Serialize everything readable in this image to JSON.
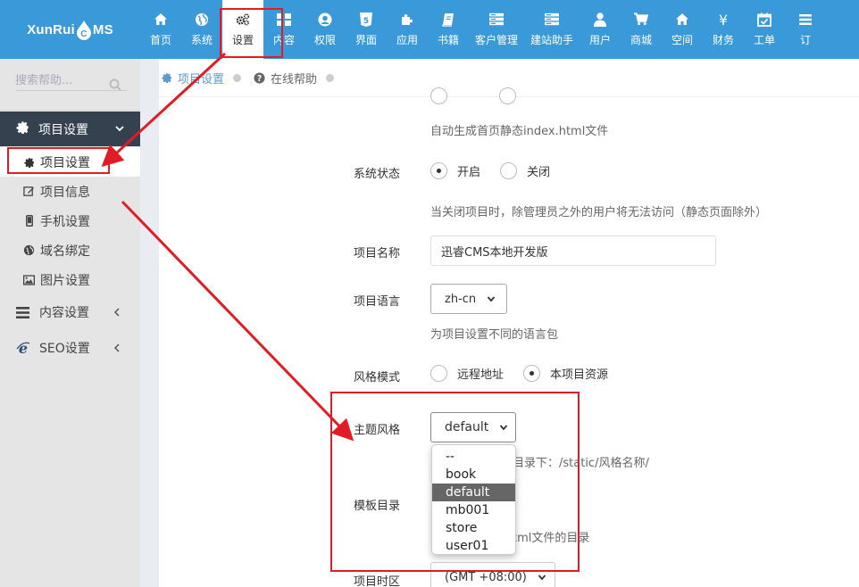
{
  "logo": {
    "text_left": "XunRui",
    "text_mid": "C",
    "text_right": "MS"
  },
  "nav": [
    {
      "label": "首页",
      "icon": "home-icon"
    },
    {
      "label": "系统",
      "icon": "globe-icon"
    },
    {
      "label": "设置",
      "icon": "gears-icon",
      "active": true
    },
    {
      "label": "内容",
      "icon": "th-large-icon"
    },
    {
      "label": "权限",
      "icon": "user-circle-icon"
    },
    {
      "label": "界面",
      "icon": "html5-icon"
    },
    {
      "label": "应用",
      "icon": "puzzle-icon"
    },
    {
      "label": "书籍",
      "icon": "book-icon"
    },
    {
      "label": "客户管理",
      "icon": "server-icon"
    },
    {
      "label": "建站助手",
      "icon": "server-icon"
    },
    {
      "label": "用户",
      "icon": "user-icon"
    },
    {
      "label": "商城",
      "icon": "cart-icon"
    },
    {
      "label": "空间",
      "icon": "home-icon"
    },
    {
      "label": "财务",
      "icon": "yen-icon"
    },
    {
      "label": "工单",
      "icon": "calendar-check-icon"
    },
    {
      "label": "订",
      "icon": "bars-icon"
    }
  ],
  "sidebar": {
    "search_placeholder": "搜索帮助...",
    "group_open": {
      "label": "项目设置"
    },
    "sub_items": [
      {
        "label": "项目设置",
        "icon": "gear-icon"
      },
      {
        "label": "项目信息",
        "icon": "edit-icon"
      },
      {
        "label": "手机设置",
        "icon": "mobile-icon"
      },
      {
        "label": "域名绑定",
        "icon": "globe-icon"
      },
      {
        "label": "图片设置",
        "icon": "image-icon"
      }
    ],
    "groups": [
      {
        "label": "内容设置",
        "icon": "bars-icon"
      },
      {
        "label": "SEO设置",
        "icon": "ie-icon"
      }
    ]
  },
  "breadcrumb": [
    {
      "label": "项目设置",
      "icon": "gear-icon"
    },
    {
      "label": "在线帮助",
      "icon": "question-circle-icon"
    }
  ],
  "form": {
    "index_help": "自动生成首页静态index.html文件",
    "status": {
      "label": "系统状态",
      "opt_on": "开启",
      "opt_off": "关闭",
      "selected": "开启",
      "help": "当关闭项目时，除管理员之外的用户将无法访问（静态页面除外）"
    },
    "name": {
      "label": "项目名称",
      "value": "迅睿CMS本地开发版"
    },
    "language": {
      "label": "项目语言",
      "value": "zh-cn",
      "help": "为项目设置不同的语言包"
    },
    "style_mode": {
      "label": "风格模式",
      "opt_remote": "远程地址",
      "opt_local": "本项目资源",
      "selected": "本项目资源"
    },
    "theme": {
      "label": "主题风格",
      "value": "default",
      "help_tail": "目录下：/static/风格名称/",
      "options": [
        "--",
        "book",
        "default",
        "mb001",
        "store",
        "user01"
      ],
      "selected": "default"
    },
    "template": {
      "label": "模板目录",
      "help_tail": "tml文件的目录"
    },
    "timezone": {
      "label": "项目时区",
      "value": "(GMT +08:00)"
    }
  },
  "colors": {
    "topbar": "#3a9ad9",
    "sidebar_head": "#364150",
    "annotation": "#e21c24"
  }
}
